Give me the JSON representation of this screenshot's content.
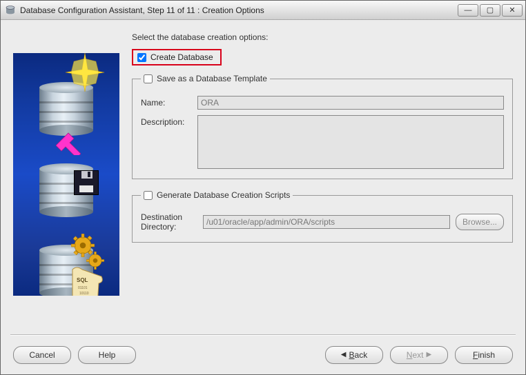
{
  "window": {
    "title": "Database Configuration Assistant, Step 11 of 11 : Creation Options"
  },
  "instruction": "Select the database creation options:",
  "createDatabase": {
    "label": "Create Database",
    "checked": true
  },
  "saveTemplate": {
    "legend": "Save as a Database Template",
    "checked": false,
    "nameLabel": "Name:",
    "nameValue": "ORA",
    "descLabel": "Description:",
    "descValue": ""
  },
  "generateScripts": {
    "legend": "Generate Database Creation Scripts",
    "checked": false,
    "destLabel": "Destination Directory:",
    "destValue": "/u01/oracle/app/admin/ORA/scripts",
    "browse": "Browse..."
  },
  "footer": {
    "cancel": "Cancel",
    "help": "Help",
    "back": "Back",
    "next": "Next",
    "finish": "Finish"
  },
  "winControls": {
    "minimize": "—",
    "maximize": "▢",
    "close": "✕"
  }
}
